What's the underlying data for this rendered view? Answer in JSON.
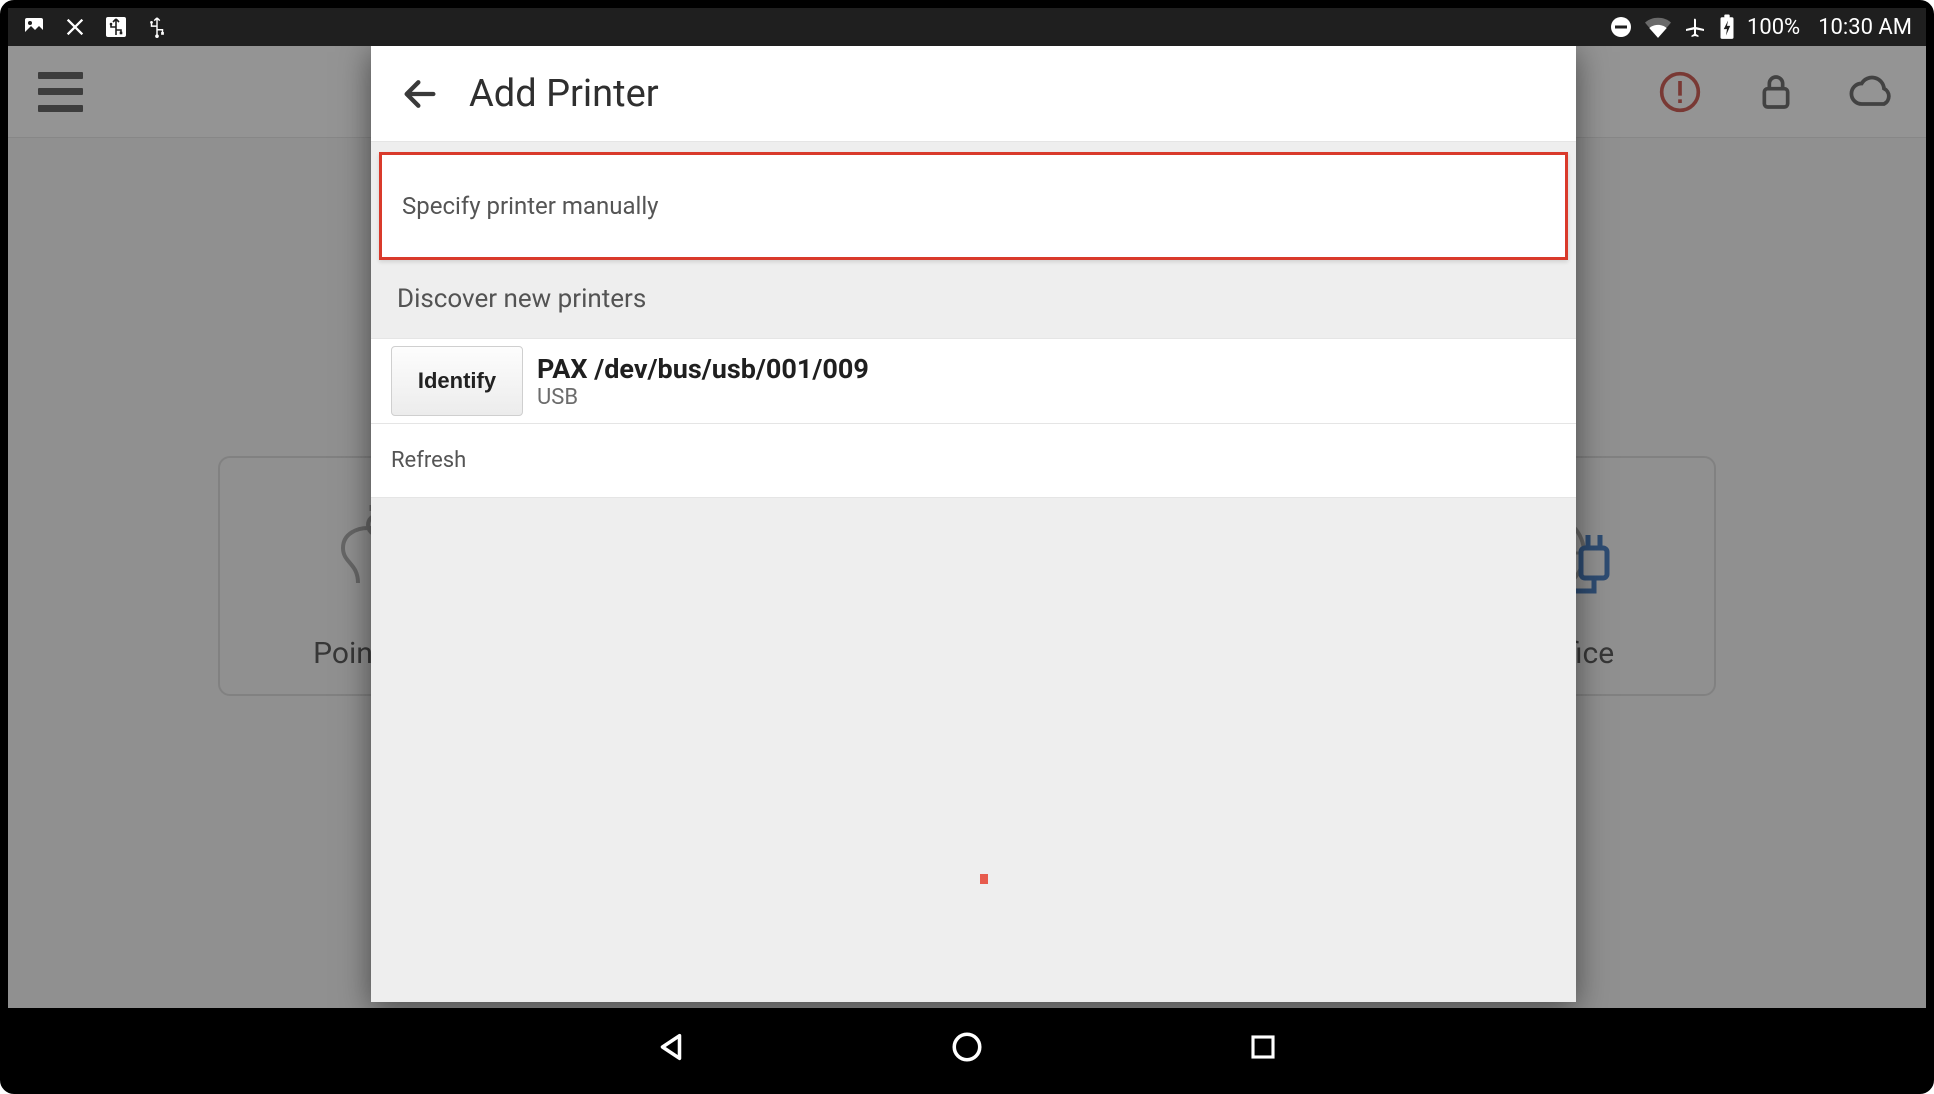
{
  "status_bar": {
    "battery_pct": "100%",
    "time": "10:30 AM"
  },
  "app_header": {
    "alert_icon": "alert-circle",
    "lock_icon": "lock",
    "cloud_icon": "cloud"
  },
  "bg_cards": {
    "left_label": "Point of S",
    "right_label": "ck Office"
  },
  "dialog": {
    "title": "Add Printer",
    "manual_label": "Specify printer manually",
    "section_label": "Discover new printers",
    "identify_label": "Identify",
    "printers": [
      {
        "name": "PAX /dev/bus/usb/001/009",
        "subtitle": "USB"
      }
    ],
    "refresh_label": "Refresh"
  }
}
